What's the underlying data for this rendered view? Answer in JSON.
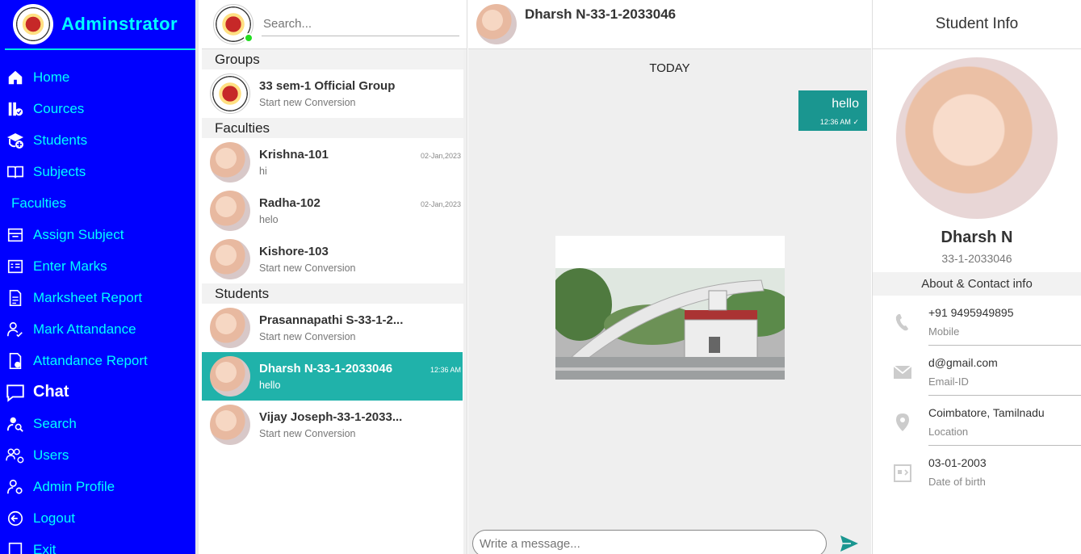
{
  "sidebar": {
    "title": "Adminstrator",
    "items": [
      {
        "label": "Home",
        "icon": "home-icon"
      },
      {
        "label": "Cources",
        "icon": "courses-icon"
      },
      {
        "label": "Students",
        "icon": "students-icon"
      },
      {
        "label": "Subjects",
        "icon": "book-icon"
      },
      {
        "label": "Faculties",
        "icon": ""
      },
      {
        "label": "Assign Subject",
        "icon": "assign-icon"
      },
      {
        "label": "Enter Marks",
        "icon": "marks-icon"
      },
      {
        "label": "Marksheet Report",
        "icon": "report-icon"
      },
      {
        "label": "Mark Attandance",
        "icon": "attendance-icon"
      },
      {
        "label": "Attandance Report",
        "icon": "attendance-report-icon"
      },
      {
        "label": "Chat",
        "icon": "chat-icon"
      },
      {
        "label": "Search",
        "icon": "search-user-icon"
      },
      {
        "label": "Users",
        "icon": "users-icon"
      },
      {
        "label": "Admin Profile",
        "icon": "admin-profile-icon"
      },
      {
        "label": "Logout",
        "icon": "logout-icon"
      },
      {
        "label": "Exit",
        "icon": "exit-icon"
      }
    ]
  },
  "chatlist": {
    "search_placeholder": "Search...",
    "groups_title": "Groups",
    "groups": [
      {
        "name": "33 sem-1 Official Group",
        "sub": "Start new Conversion",
        "date": ""
      }
    ],
    "faculties_title": "Faculties",
    "faculties": [
      {
        "name": "Krishna-101",
        "sub": "hi",
        "date": "02-Jan,2023"
      },
      {
        "name": "Radha-102",
        "sub": "helo",
        "date": "02-Jan,2023"
      },
      {
        "name": "Kishore-103",
        "sub": "Start new Conversion",
        "date": ""
      }
    ],
    "students_title": "Students",
    "students": [
      {
        "name": "Prasannapathi S-33-1-2...",
        "sub": "Start new Conversion",
        "date": ""
      },
      {
        "name": "Dharsh N-33-1-2033046",
        "sub": "hello",
        "date": "12:36 AM"
      },
      {
        "name": "Vijay Joseph-33-1-2033...",
        "sub": "Start new Conversion",
        "date": ""
      }
    ]
  },
  "conversation": {
    "title": "Dharsh N-33-1-2033046",
    "day_label": "TODAY",
    "message": {
      "text": "hello",
      "time": "12:36 AM"
    },
    "composer_placeholder": "Write a message..."
  },
  "info": {
    "header": "Student Info",
    "name": "Dharsh N",
    "id": "33-1-2033046",
    "section": "About & Contact info",
    "rows": [
      {
        "value": "+91 9495949895",
        "label": "Mobile",
        "icon": "phone-icon"
      },
      {
        "value": "d@gmail.com",
        "label": "Email-ID",
        "icon": "mail-icon"
      },
      {
        "value": "Coimbatore, Tamilnadu",
        "label": "Location",
        "icon": "location-icon"
      },
      {
        "value": "03-01-2003",
        "label": "Date of birth",
        "icon": "calendar-icon"
      }
    ]
  },
  "colors": {
    "sidebar_bg": "#0000ff",
    "sidebar_text": "#00ffff",
    "accent": "#20b2aa",
    "bubble": "#1a9690"
  }
}
